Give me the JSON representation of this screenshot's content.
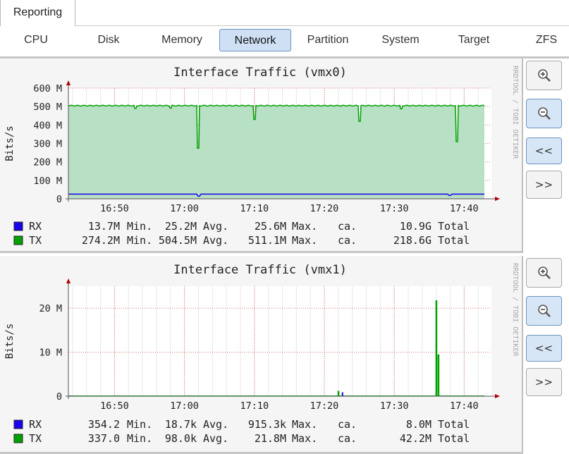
{
  "top_tab": {
    "label": "Reporting"
  },
  "subnav": {
    "items": [
      {
        "label": "CPU",
        "active": false
      },
      {
        "label": "Disk",
        "active": false
      },
      {
        "label": "Memory",
        "active": false
      },
      {
        "label": "Network",
        "active": true
      },
      {
        "label": "Partition",
        "active": false
      },
      {
        "label": "System",
        "active": false
      },
      {
        "label": "Target",
        "active": false
      },
      {
        "label": "ZFS",
        "active": false
      }
    ]
  },
  "watermark": "RRDTOOL / TOBI OETIKER",
  "colors": {
    "rx": "#1a00ee",
    "tx": "#00a100",
    "tx_fill": "#b7e0c4",
    "grid": "#e07070",
    "axis": "#b00000"
  },
  "graph_buttons": {
    "zoom_in_icon": "zoom-in-icon",
    "zoom_out_icon": "zoom-out-icon",
    "prev_label": "<<",
    "next_label": ">>"
  },
  "chart_data": [
    {
      "type": "area",
      "title": "Interface Traffic (vmx0)",
      "ylabel": "Bits/s",
      "x_tick_labels": [
        "16:50",
        "17:00",
        "17:10",
        "17:20",
        "17:30",
        "17:40"
      ],
      "y_tick_labels": [
        "0",
        "100 M",
        "200 M",
        "300 M",
        "400 M",
        "500 M",
        "600 M"
      ],
      "ylim": [
        0,
        600
      ],
      "y_unit": "M",
      "series": [
        {
          "name": "RX",
          "baseline": 25.2,
          "dips": [
            {
              "t": "17:02",
              "v": 13.7
            },
            {
              "t": "17:38",
              "v": 18
            }
          ]
        },
        {
          "name": "TX",
          "baseline": 505,
          "dips": [
            {
              "t": "16:53",
              "v": 490
            },
            {
              "t": "16:58",
              "v": 492
            },
            {
              "t": "17:02",
              "v": 274
            },
            {
              "t": "17:02",
              "v": 480
            },
            {
              "t": "17:10",
              "v": 430
            },
            {
              "t": "17:25",
              "v": 420
            },
            {
              "t": "17:31",
              "v": 488
            },
            {
              "t": "17:39",
              "v": 310
            }
          ]
        }
      ],
      "legend": [
        {
          "name": "RX",
          "min": "13.7M",
          "avg": "25.2M",
          "max": "25.6M",
          "total": "10.9G"
        },
        {
          "name": "TX",
          "min": "274.2M",
          "avg": "504.5M",
          "max": "511.1M",
          "total": "218.6G"
        }
      ],
      "legend_words": {
        "min": "Min.",
        "avg": "Avg.",
        "max": "Max.",
        "ca": "ca.",
        "total": "Total"
      },
      "grid": true
    },
    {
      "type": "line",
      "title": "Interface Traffic (vmx1)",
      "ylabel": "Bits/s",
      "x_tick_labels": [
        "16:50",
        "17:00",
        "17:10",
        "17:20",
        "17:30",
        "17:40"
      ],
      "y_tick_labels": [
        "0",
        "10 M",
        "20 M"
      ],
      "ylim": [
        0,
        25
      ],
      "y_unit": "M",
      "series": [
        {
          "name": "RX",
          "baseline": 0.02,
          "spikes": [
            {
              "t": "17:22.5",
              "v": 0.9
            }
          ]
        },
        {
          "name": "TX",
          "baseline": 0.1,
          "spikes": [
            {
              "t": "17:22",
              "v": 1.2
            },
            {
              "t": "17:36",
              "v": 21.8
            },
            {
              "t": "17:36.3",
              "v": 9.5
            }
          ]
        }
      ],
      "legend": [
        {
          "name": "RX",
          "min": "354.2",
          "avg": "18.7k",
          "max": "915.3k",
          "total": "8.0M"
        },
        {
          "name": "TX",
          "min": "337.0",
          "avg": "98.0k",
          "max": "21.8M",
          "total": "42.2M"
        }
      ],
      "legend_words": {
        "min": "Min.",
        "avg": "Avg.",
        "max": "Max.",
        "ca": "ca.",
        "total": "Total"
      },
      "grid": true
    }
  ]
}
